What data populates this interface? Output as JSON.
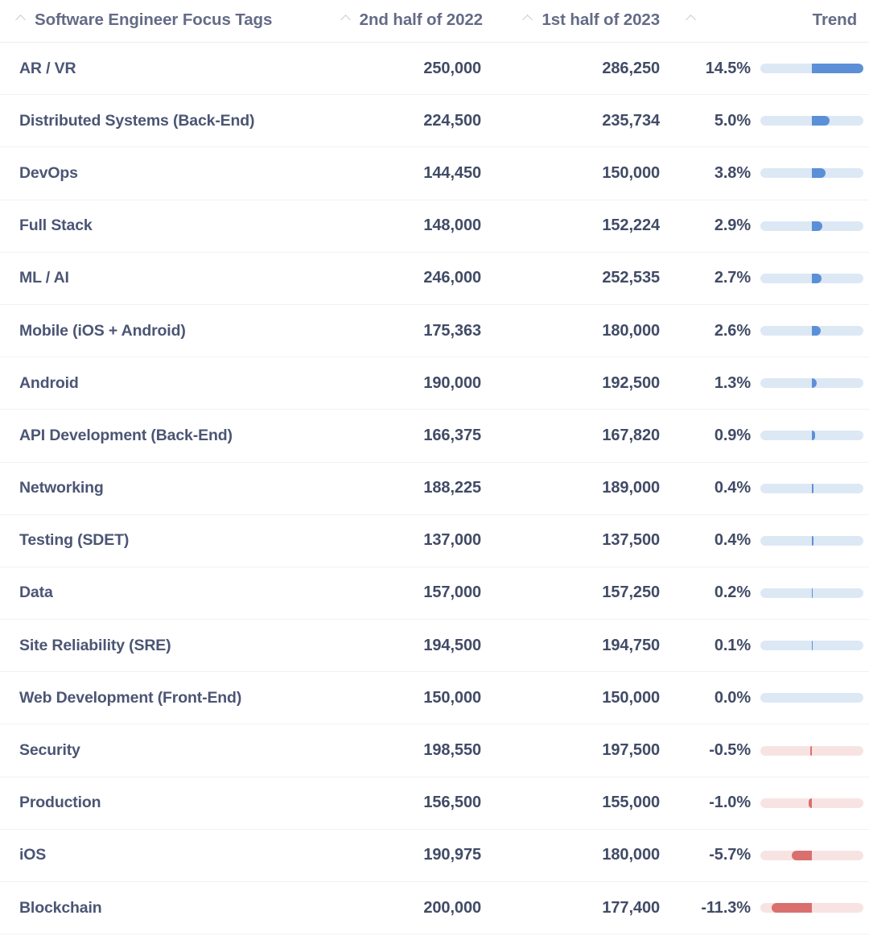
{
  "header": {
    "columns": [
      {
        "label": "Software Engineer Focus Tags",
        "sortable": true,
        "align": "left"
      },
      {
        "label": "2nd half of 2022",
        "sortable": true,
        "align": "right"
      },
      {
        "label": "1st half of 2023",
        "sortable": true,
        "align": "right"
      },
      {
        "label": "",
        "sortable": true,
        "align": "right"
      },
      {
        "label": "Trend",
        "sortable": false,
        "align": "right"
      }
    ],
    "sort_icon": "chevron-up-icon"
  },
  "colors": {
    "positive_fill": "#5b90d8",
    "positive_track": "#dde8f5",
    "negative_fill": "#d9706e",
    "negative_track": "#f8e3e3",
    "label_text": "#4b5574",
    "value_text": "#414b66",
    "header_text": "#646b86",
    "row_divider": "#f0f1f4"
  },
  "chart_data": {
    "type": "table",
    "title": "Software Engineer Focus Tags",
    "columns": [
      "Software Engineer Focus Tags",
      "2nd half of 2022",
      "1st half of 2023",
      "Trend %",
      "Trend"
    ],
    "trend_scale_max_percent": 14.5,
    "rows": [
      {
        "label": "AR / VR",
        "prev": "250,000",
        "curr": "286,250",
        "pct": "14.5%",
        "pct_value": 14.5,
        "prev_value": 250000,
        "curr_value": 286250
      },
      {
        "label": "Distributed Systems (Back-End)",
        "prev": "224,500",
        "curr": "235,734",
        "pct": "5.0%",
        "pct_value": 5.0,
        "prev_value": 224500,
        "curr_value": 235734
      },
      {
        "label": "DevOps",
        "prev": "144,450",
        "curr": "150,000",
        "pct": "3.8%",
        "pct_value": 3.8,
        "prev_value": 144450,
        "curr_value": 150000
      },
      {
        "label": "Full Stack",
        "prev": "148,000",
        "curr": "152,224",
        "pct": "2.9%",
        "pct_value": 2.9,
        "prev_value": 148000,
        "curr_value": 152224
      },
      {
        "label": "ML / AI",
        "prev": "246,000",
        "curr": "252,535",
        "pct": "2.7%",
        "pct_value": 2.7,
        "prev_value": 246000,
        "curr_value": 252535
      },
      {
        "label": "Mobile (iOS + Android)",
        "prev": "175,363",
        "curr": "180,000",
        "pct": "2.6%",
        "pct_value": 2.6,
        "prev_value": 175363,
        "curr_value": 180000
      },
      {
        "label": "Android",
        "prev": "190,000",
        "curr": "192,500",
        "pct": "1.3%",
        "pct_value": 1.3,
        "prev_value": 190000,
        "curr_value": 192500
      },
      {
        "label": "API Development (Back-End)",
        "prev": "166,375",
        "curr": "167,820",
        "pct": "0.9%",
        "pct_value": 0.9,
        "prev_value": 166375,
        "curr_value": 167820
      },
      {
        "label": "Networking",
        "prev": "188,225",
        "curr": "189,000",
        "pct": "0.4%",
        "pct_value": 0.4,
        "prev_value": 188225,
        "curr_value": 189000
      },
      {
        "label": "Testing (SDET)",
        "prev": "137,000",
        "curr": "137,500",
        "pct": "0.4%",
        "pct_value": 0.4,
        "prev_value": 137000,
        "curr_value": 137500
      },
      {
        "label": "Data",
        "prev": "157,000",
        "curr": "157,250",
        "pct": "0.2%",
        "pct_value": 0.2,
        "prev_value": 157000,
        "curr_value": 157250
      },
      {
        "label": "Site Reliability (SRE)",
        "prev": "194,500",
        "curr": "194,750",
        "pct": "0.1%",
        "pct_value": 0.1,
        "prev_value": 194500,
        "curr_value": 194750
      },
      {
        "label": "Web Development (Front-End)",
        "prev": "150,000",
        "curr": "150,000",
        "pct": "0.0%",
        "pct_value": 0.0,
        "prev_value": 150000,
        "curr_value": 150000
      },
      {
        "label": "Security",
        "prev": "198,550",
        "curr": "197,500",
        "pct": "-0.5%",
        "pct_value": -0.5,
        "prev_value": 198550,
        "curr_value": 197500
      },
      {
        "label": "Production",
        "prev": "156,500",
        "curr": "155,000",
        "pct": "-1.0%",
        "pct_value": -1.0,
        "prev_value": 156500,
        "curr_value": 155000
      },
      {
        "label": "iOS",
        "prev": "190,975",
        "curr": "180,000",
        "pct": "-5.7%",
        "pct_value": -5.7,
        "prev_value": 190975,
        "curr_value": 180000
      },
      {
        "label": "Blockchain",
        "prev": "200,000",
        "curr": "177,400",
        "pct": "-11.3%",
        "pct_value": -11.3,
        "prev_value": 200000,
        "curr_value": 177400
      }
    ]
  }
}
